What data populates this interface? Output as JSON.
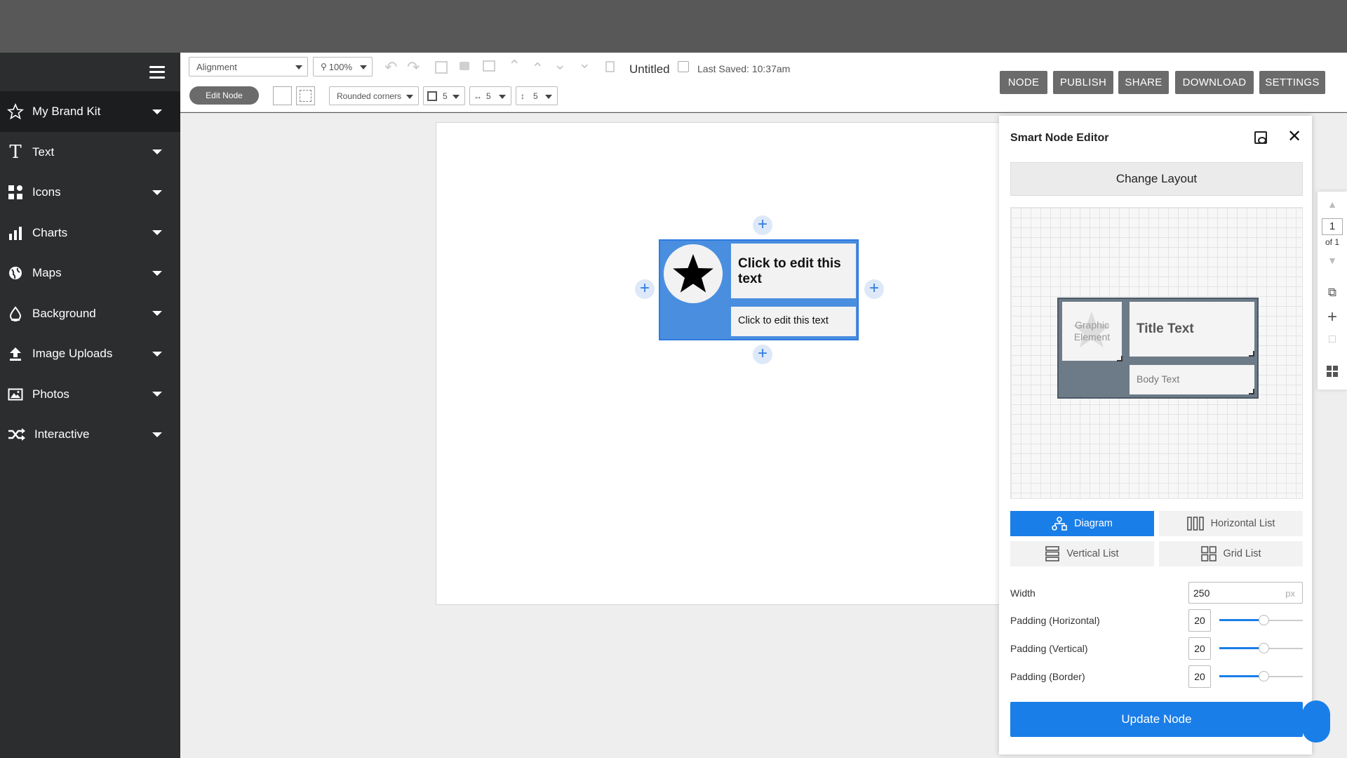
{
  "sidebar": {
    "items": [
      {
        "label": "My Brand Kit",
        "icon": "star-outline-icon"
      },
      {
        "label": "Text",
        "icon": "text-t-icon"
      },
      {
        "label": "Icons",
        "icon": "icons-grid-icon"
      },
      {
        "label": "Charts",
        "icon": "bar-chart-icon"
      },
      {
        "label": "Maps",
        "icon": "globe-icon"
      },
      {
        "label": "Background",
        "icon": "paint-drop-icon"
      },
      {
        "label": "Image Uploads",
        "icon": "upload-icon"
      },
      {
        "label": "Photos",
        "icon": "photo-icon"
      },
      {
        "label": "Interactive",
        "icon": "shuffle-icon"
      }
    ]
  },
  "toolbar": {
    "alignment": "Alignment",
    "zoom": "100%",
    "doc_title": "Untitled",
    "last_saved": "Last Saved: 10:37am",
    "edit_node": "Edit Node",
    "corners": "Rounded corners",
    "border_width": "5",
    "h_spacing": "5",
    "v_spacing": "5",
    "buttons": {
      "node": "NODE",
      "publish": "PUBLISH",
      "share": "SHARE",
      "download": "DOWNLOAD",
      "settings": "SETTINGS"
    }
  },
  "canvas": {
    "node": {
      "title": "Click to edit this text",
      "body": "Click to edit this text"
    }
  },
  "panel": {
    "title": "Smart Node Editor",
    "change_layout": "Change Layout",
    "preview": {
      "graphic": "Graphic Element",
      "title": "Title Text",
      "body": "Body Text"
    },
    "layouts": {
      "diagram": "Diagram",
      "horizontal_list": "Horizontal List",
      "vertical_list": "Vertical List",
      "grid_list": "Grid List"
    },
    "width_label": "Width",
    "width_value": "250",
    "width_unit": "px",
    "padding_h_label": "Padding (Horizontal)",
    "padding_h_value": "20",
    "padding_v_label": "Padding (Vertical)",
    "padding_v_value": "20",
    "padding_b_label": "Padding (Border)",
    "padding_b_value": "20",
    "update": "Update Node"
  },
  "pager": {
    "current": "1",
    "of": "of 1"
  },
  "colors": {
    "accent": "#1a7ee8",
    "node_fill": "#4a8ee0",
    "sidebar": "#2b2d2f"
  }
}
